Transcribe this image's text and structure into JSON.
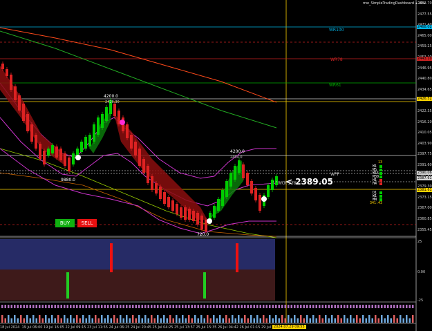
{
  "header": {
    "indicator_title": "mw_SimpleTradingDashboard ◂ 1R ▸"
  },
  "price_axis": {
    "ticks": [
      "2483.70",
      "2477.55",
      "2471.40",
      "2465.00",
      "2459.25",
      "2453.10",
      "2446.95",
      "2440.80",
      "2434.65",
      "2428.50",
      "2422.35",
      "2416.20",
      "2410.05",
      "2403.90",
      "2397.75",
      "2391.60",
      "2385.45",
      "2379.30",
      "2373.15",
      "2367.00",
      "2360.85",
      "2355.45"
    ],
    "boxes": [
      {
        "label": "2468.02",
        "color": "#00b4e6"
      },
      {
        "label": "2443.10",
        "color": "#cc2222"
      },
      {
        "label": "2426.52",
        "color": "#ffd400"
      },
      {
        "label": "2390.06",
        "color": "#cfcfcf"
      },
      {
        "label": "2387.61",
        "color": "#d8d8d8"
      },
      {
        "label": "2381.61",
        "color": "#ffd400"
      }
    ]
  },
  "levels": {
    "wr100": "WR100",
    "wr78": "WR78",
    "wr61": "WR61",
    "wpp": "WPP",
    "wr0": "WOt 238"
  },
  "annotations": {
    "high1": "4200.0",
    "high1_sub": "2426.30",
    "high2": "4200.0",
    "high2_sub": "2404.0",
    "low1": "9880.0",
    "low2": "720.0",
    "current_price": "< 2389.05"
  },
  "buttons": {
    "buy": "BUY",
    "sell": "SELL"
  },
  "dashboard": {
    "first": "13",
    "rows": [
      "M1",
      "M5",
      "M15",
      "M30",
      "H1",
      "H4",
      "D1",
      "W1",
      "MN"
    ],
    "total": "341:43"
  },
  "osc_axis": [
    "25",
    "0.00",
    "-25"
  ],
  "time_axis": [
    "18 Jul 2024",
    "19 Jul 06:00",
    "19 Jul 16:05",
    "22 Jul 09:15",
    "23 Jul 11:55",
    "24 Jul 06:25",
    "24 Jul 20:45",
    "25 Jul 04:25",
    "25 Jul 13:57",
    "25 Jul 15:35",
    "26 Jul 04:42",
    "26 Jul 01:15",
    "29 Jul 18"
  ],
  "time_cursor": "2024.07.29 09:55",
  "colors": {
    "bull": "#00cc00",
    "bear": "#dd2222",
    "accent": "#ffd400",
    "panel_blue": "#262b66",
    "panel_red": "#3e1a1a"
  }
}
